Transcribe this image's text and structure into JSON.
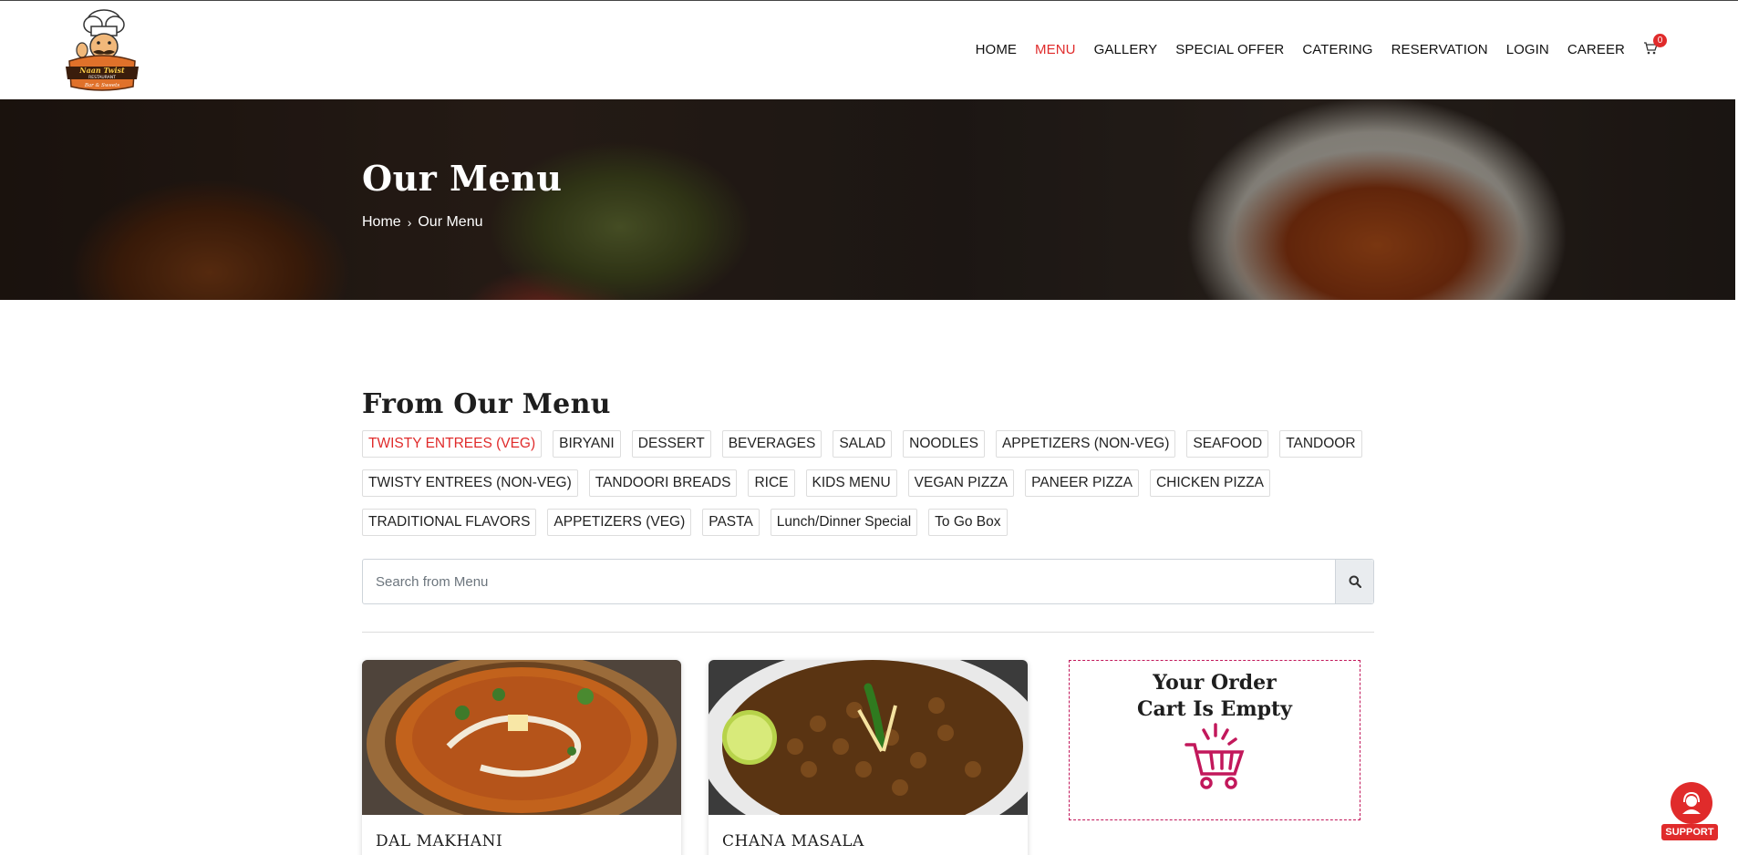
{
  "logo": {
    "line1": "Naan Twist",
    "line2": "RESTAURANT",
    "line3": "Bar & Sweets"
  },
  "nav": {
    "items": [
      "HOME",
      "MENU",
      "GALLERY",
      "SPECIAL OFFER",
      "CATERING",
      "RESERVATION",
      "LOGIN",
      "CAREER"
    ],
    "active": "MENU",
    "cart_count": "0"
  },
  "hero": {
    "title": "Our Menu",
    "breadcrumb": {
      "home": "Home",
      "current": "Our Menu"
    }
  },
  "menu": {
    "title": "From Our Menu",
    "categories": [
      [
        "TWISTY ENTREES (VEG)",
        "BIRYANI",
        "DESSERT",
        "BEVERAGES",
        "SALAD",
        "NOODLES",
        "APPETIZERS (NON-VEG)",
        "SEAFOOD",
        "TANDOOR"
      ],
      [
        "TWISTY ENTREES (NON-VEG)",
        "TANDOORI BREADS",
        "RICE",
        "KIDS MENU",
        "VEGAN PIZZA",
        "PANEER PIZZA",
        "CHICKEN PIZZA"
      ],
      [
        "TRADITIONAL FLAVORS",
        "APPETIZERS (VEG)",
        "PASTA",
        "Lunch/Dinner Special",
        "To Go Box"
      ]
    ],
    "active_category": "TWISTY ENTREES (VEG)",
    "search": {
      "placeholder": "Search from Menu"
    },
    "items": [
      {
        "name": "DAL MAKHANI"
      },
      {
        "name": "CHANA MASALA"
      }
    ]
  },
  "order": {
    "line1": "Your Order",
    "line2": "Cart Is Empty"
  },
  "support": {
    "label": "SUPPORT"
  },
  "colors": {
    "accent": "#e02b2b",
    "order_border": "#c2185b"
  }
}
